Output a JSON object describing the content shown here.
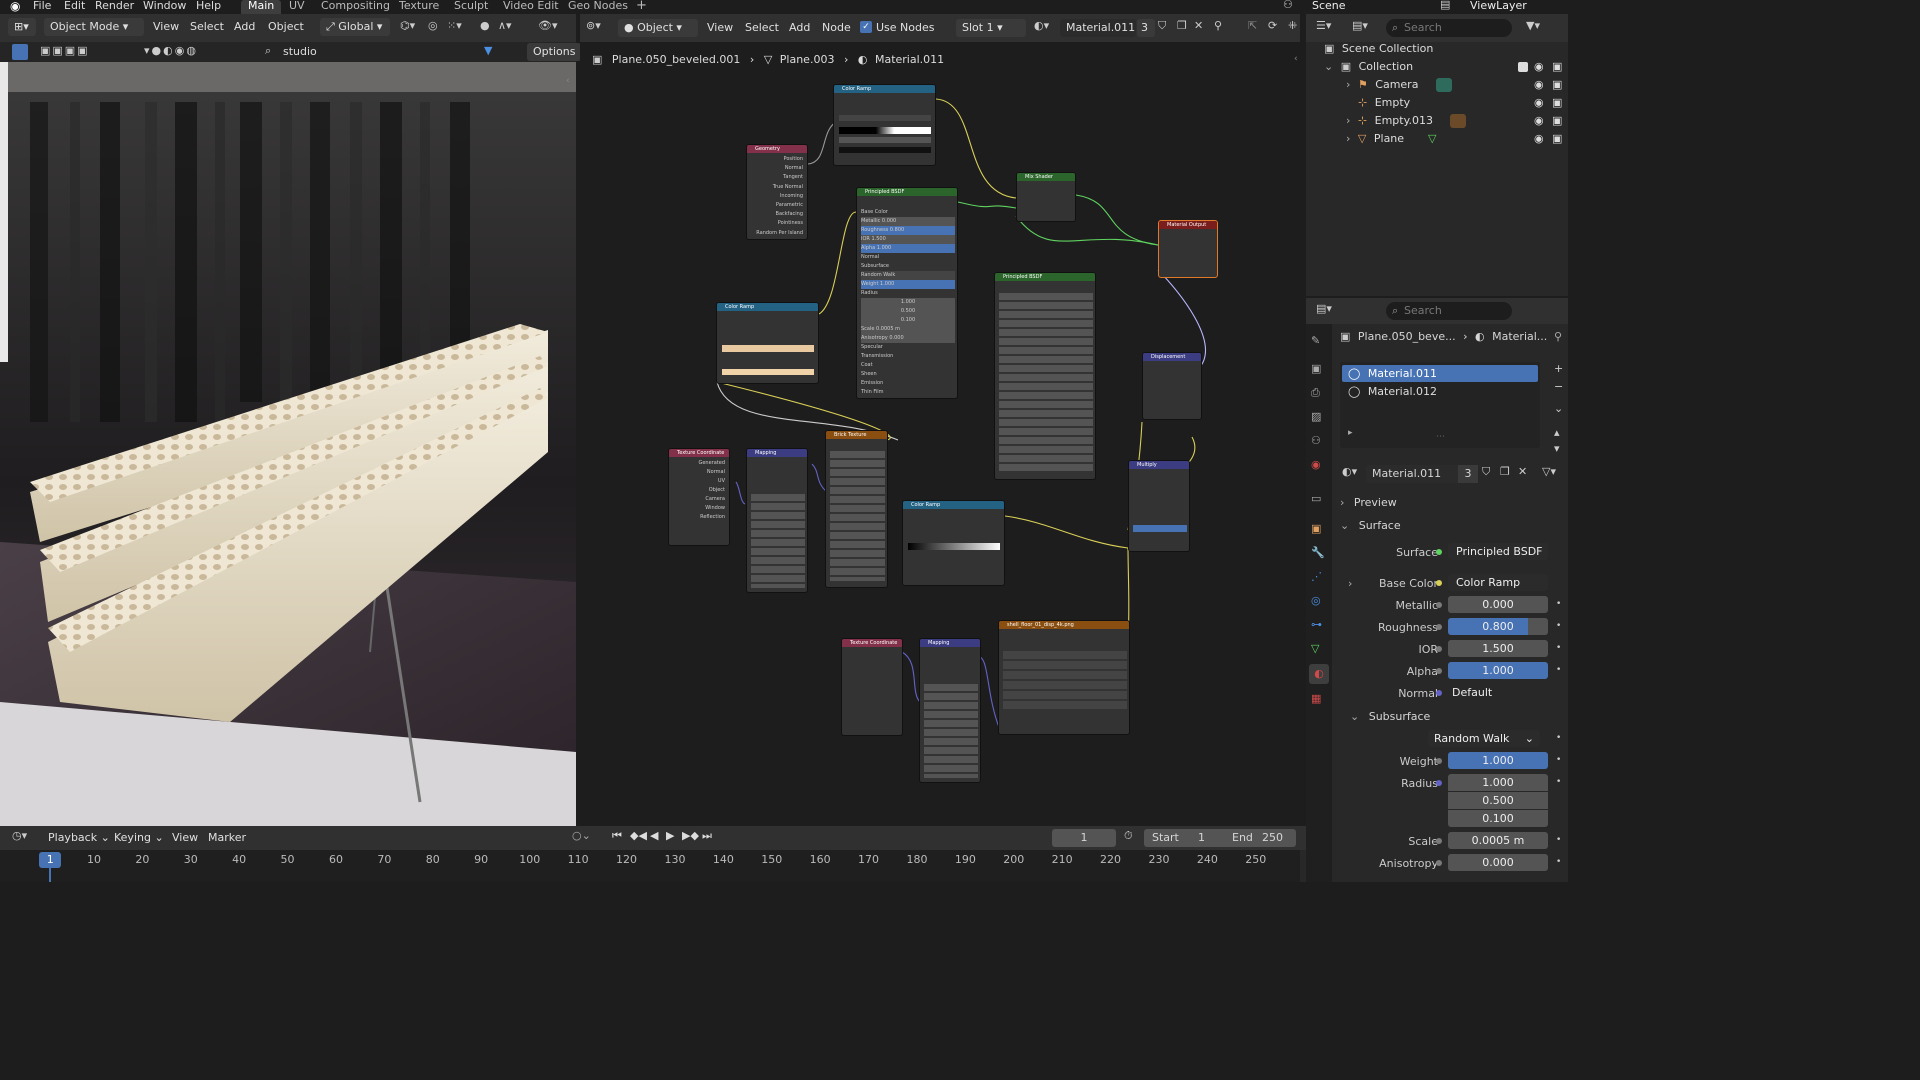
{
  "topbar": {
    "menus": [
      "File",
      "Edit",
      "Render",
      "Window",
      "Help"
    ],
    "workspaces": [
      "Main",
      "UV",
      "Compositing",
      "Texture",
      "Sculpt",
      "Video Edit",
      "Geo Nodes"
    ],
    "active_workspace": "Main",
    "scene": "Scene",
    "view_layer": "ViewLayer"
  },
  "viewport_header": {
    "mode": "Object Mode",
    "menus": [
      "View",
      "Select",
      "Add",
      "Object"
    ],
    "transform": "Global",
    "world_name": "studio",
    "options": "Options"
  },
  "node_header": {
    "editor_type": "Object",
    "menus": [
      "View",
      "Select",
      "Add",
      "Node"
    ],
    "use_nodes": "Use Nodes",
    "slot": "Slot 1",
    "material": "Material.011",
    "users": "3"
  },
  "breadcrumb": [
    "Plane.050_beveled.001",
    "Plane.003",
    "Material.011"
  ],
  "nodes": {
    "color_ramp_top": "Color Ramp",
    "geometry": "Geometry",
    "geometry_outputs": [
      "Position",
      "Normal",
      "Tangent",
      "True Normal",
      "Incoming",
      "Parametric",
      "Backfacing",
      "Pointiness",
      "Random Per Island"
    ],
    "principled1": "Principled BSDF",
    "principled2": "Principled BSDF",
    "mix_shader": "Mix Shader",
    "material_output": "Material Output",
    "color_ramp_mid": "Color Ramp",
    "displacement": "Displacement",
    "brick_texture": "Brick Texture",
    "texture_coord1": "Texture Coordinate",
    "texture_coord2": "Texture Coordinate",
    "mapping1": "Mapping",
    "mapping2": "Mapping",
    "color_ramp_low": "Color Ramp",
    "multiply": "Multiply",
    "image_texture": "shell_floor_01_disp_4k.png",
    "texcoord_outputs": [
      "Generated",
      "Normal",
      "UV",
      "Object",
      "Camera",
      "Window",
      "Reflection"
    ],
    "bsdf_rows": [
      "Base Color",
      "Metallic 0.000",
      "Roughness 0.800",
      "IOR 1.500",
      "Alpha 1.000",
      "Normal",
      "Subsurface",
      "Random Walk",
      "Weight 1.000",
      "Radius",
      "1.000",
      "0.500",
      "0.100",
      "Scale 0.0005 m",
      "Anisotropy 0.000",
      "Specular",
      "Transmission",
      "Coat",
      "Sheen",
      "Emission",
      "Thin Film"
    ]
  },
  "outliner": {
    "search_placeholder": "Search",
    "scene_collection": "Scene Collection",
    "collection": "Collection",
    "items": [
      "Camera",
      "Empty",
      "Empty.013",
      "Plane"
    ]
  },
  "properties": {
    "search_placeholder": "Search",
    "breadcrumb_object": "Plane.050_beve...",
    "breadcrumb_material": "Material...",
    "slots": [
      "Material.011",
      "Material.012"
    ],
    "material_name": "Material.011",
    "material_users": "3",
    "preview": "Preview",
    "surface_panel": "Surface",
    "surface_label": "Surface",
    "surface_value": "Principled BSDF",
    "base_color_label": "Base Color",
    "base_color_value": "Color Ramp",
    "metallic_label": "Metallic",
    "metallic_value": "0.000",
    "roughness_label": "Roughness",
    "roughness_value": "0.800",
    "roughness_fill": 0.8,
    "ior_label": "IOR",
    "ior_value": "1.500",
    "alpha_label": "Alpha",
    "alpha_value": "1.000",
    "normal_label": "Normal",
    "normal_value": "Default",
    "subsurface_panel": "Subsurface",
    "subsurface_method": "Random Walk",
    "weight_label": "Weight",
    "weight_value": "1.000",
    "radius_label": "Radius",
    "radius_values": [
      "1.000",
      "0.500",
      "0.100"
    ],
    "scale_label": "Scale",
    "scale_value": "0.0005 m",
    "anisotropy_label": "Anisotropy",
    "anisotropy_value": "0.000"
  },
  "timeline": {
    "menus": [
      "Playback",
      "Keying",
      "View",
      "Marker"
    ],
    "current_frame": "1",
    "start_label": "Start",
    "start_value": "1",
    "end_label": "End",
    "end_value": "250",
    "ticks": [
      "1",
      "10",
      "20",
      "30",
      "40",
      "50",
      "60",
      "70",
      "80",
      "90",
      "100",
      "110",
      "120",
      "130",
      "140",
      "150",
      "160",
      "170",
      "180",
      "190",
      "200",
      "210",
      "220",
      "230",
      "240",
      "250"
    ]
  },
  "colors": {
    "accent_blue": "#4772b3",
    "header_bg": "#303030",
    "panel_bg": "#282828",
    "node_converter": "#246283",
    "node_shader": "#2b652b",
    "node_input": "#83314a",
    "node_texture": "#8a4f10",
    "node_vector": "#3c3c83",
    "node_output": "#7a1d1d"
  }
}
